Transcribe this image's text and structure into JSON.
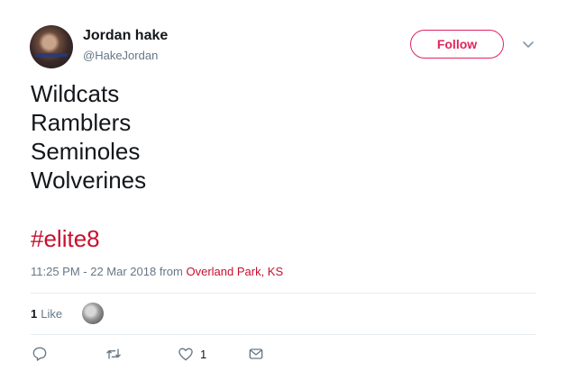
{
  "user": {
    "name": "Jordan hake",
    "handle": "@HakeJordan"
  },
  "follow_button": {
    "label": "Follow"
  },
  "tweet": {
    "lines": [
      "Wildcats",
      "Ramblers",
      "Seminoles",
      "Wolverines"
    ],
    "hashtag": "#elite8",
    "timestamp": "11:25 PM - 22 Mar 2018",
    "from_label": "from",
    "location": "Overland Park, KS"
  },
  "engagement": {
    "likes_count": "1",
    "likes_label": "Like"
  },
  "actions": {
    "reply_icon": "reply-icon",
    "retweet_icon": "retweet-icon",
    "like_icon": "heart-icon",
    "like_count": "1",
    "dm_icon": "mail-icon"
  },
  "colors": {
    "accent": "#e0245e",
    "link": "#c8102e",
    "secondary_text": "#657786",
    "divider": "#e6ecf0"
  }
}
